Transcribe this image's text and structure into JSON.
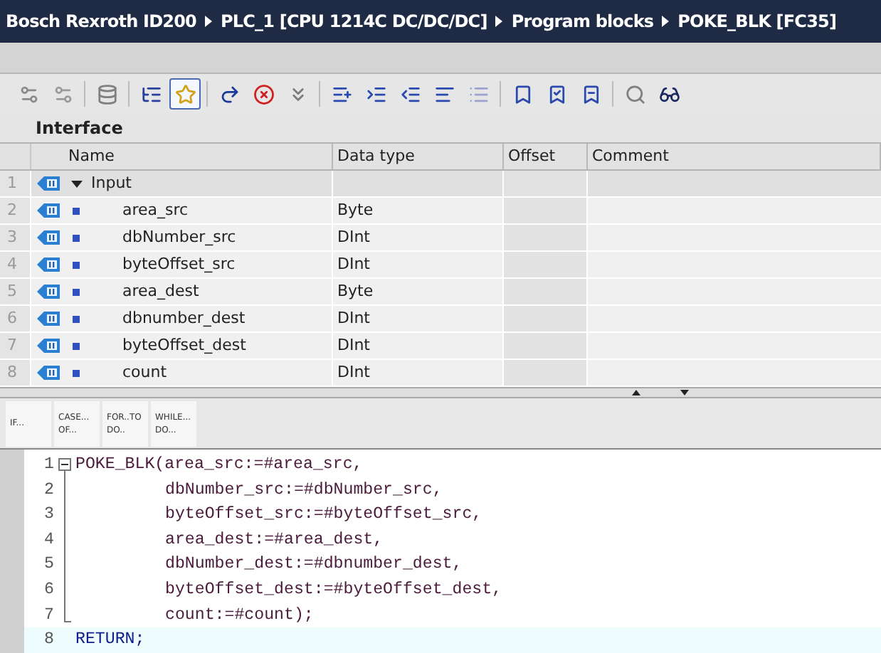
{
  "breadcrumb": [
    "Bosch Rexroth ID200",
    "PLC_1 [CPU 1214C DC/DC/DC]",
    "Program blocks",
    "POKE_BLK [FC35]"
  ],
  "toolbar": [
    {
      "selected": false
    },
    {
      "selected": false
    },
    {
      "selected": false
    },
    {
      "selected": false
    },
    {
      "selected": true
    },
    {
      "selected": false
    },
    {
      "selected": false
    },
    {
      "selected": false
    },
    {
      "selected": false
    },
    {
      "selected": false
    },
    {
      "selected": false
    },
    {
      "selected": false
    },
    {
      "selected": false
    },
    {
      "selected": false
    },
    {
      "selected": false
    },
    {
      "selected": false
    },
    {
      "selected": false
    },
    {
      "selected": false
    }
  ],
  "interface": {
    "title": "Interface",
    "columns": [
      "Name",
      "Data type",
      "Offset",
      "Comment"
    ],
    "rows": [
      {
        "number": "1",
        "kind": "section",
        "name": "Input",
        "data_type": "",
        "expanded": true
      },
      {
        "number": "2",
        "kind": "parameter",
        "name": "area_src",
        "data_type": "Byte"
      },
      {
        "number": "3",
        "kind": "parameter",
        "name": "dbNumber_src",
        "data_type": "DInt"
      },
      {
        "number": "4",
        "kind": "parameter",
        "name": "byteOffset_src",
        "data_type": "DInt"
      },
      {
        "number": "5",
        "kind": "parameter",
        "name": "area_dest",
        "data_type": "Byte"
      },
      {
        "number": "6",
        "kind": "parameter",
        "name": "dbnumber_dest",
        "data_type": "DInt"
      },
      {
        "number": "7",
        "kind": "parameter",
        "name": "byteOffset_dest",
        "data_type": "DInt"
      },
      {
        "number": "8",
        "kind": "parameter",
        "name": "count",
        "data_type": "DInt"
      }
    ]
  },
  "snippets": [
    {
      "lines": [
        "IF..."
      ]
    },
    {
      "lines": [
        "CASE...",
        "OF..."
      ]
    },
    {
      "lines": [
        "FOR..TO",
        "DO.."
      ]
    },
    {
      "lines": [
        "WHILE...",
        "DO..."
      ]
    }
  ],
  "code": [
    {
      "number": "1",
      "kind": "call",
      "text": "POKE_BLK(area_src:=#area_src,",
      "expanded": true,
      "in_block": false,
      "current": false
    },
    {
      "number": "2",
      "kind": "continuation",
      "text": "dbNumber_src:=#dbNumber_src,",
      "in_block": true,
      "current": false
    },
    {
      "number": "3",
      "kind": "continuation",
      "text": "byteOffset_src:=#byteOffset_src,",
      "in_block": true,
      "current": false
    },
    {
      "number": "4",
      "kind": "continuation",
      "text": "area_dest:=#area_dest,",
      "in_block": true,
      "current": false
    },
    {
      "number": "5",
      "kind": "continuation",
      "text": "dbNumber_dest:=#dbnumber_dest,",
      "in_block": true,
      "current": false
    },
    {
      "number": "6",
      "kind": "continuation",
      "text": "byteOffset_dest:=#byteOffset_dest,",
      "in_block": true,
      "current": false
    },
    {
      "number": "7",
      "kind": "continuation",
      "text": "count:=#count);",
      "in_block": true,
      "current": false
    },
    {
      "number": "8",
      "kind": "keyword",
      "text": "RETURN;",
      "in_block": false,
      "current": true
    }
  ]
}
